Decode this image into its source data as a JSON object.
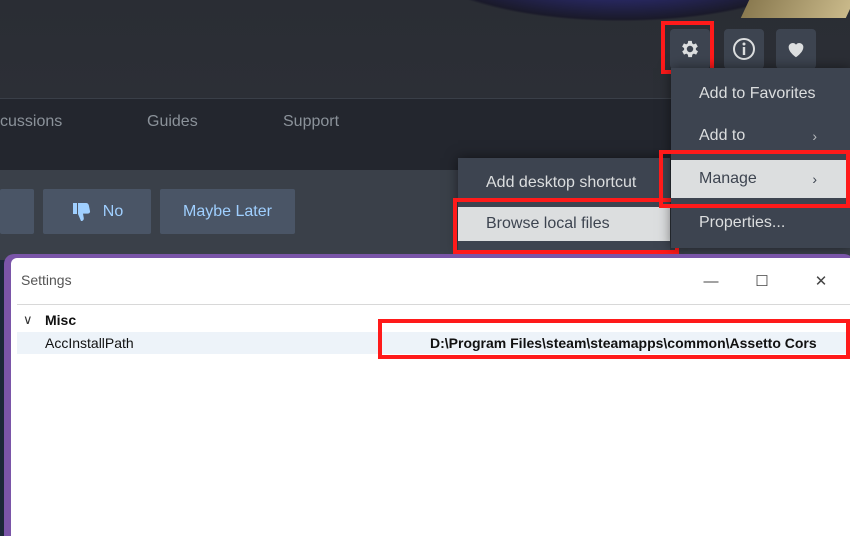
{
  "tabs": [
    "cussions",
    "Guides",
    "Support"
  ],
  "review_buttons": {
    "no": "No",
    "later": "Maybe Later"
  },
  "icons": {
    "settings": "gear-icon",
    "info": "info-icon",
    "favorite": "heart-icon",
    "thumb": "thumbs-down-icon"
  },
  "main_menu": {
    "items": [
      {
        "label": "Add to Favorites",
        "chevron": ""
      },
      {
        "label": "Add to",
        "chevron": "›"
      },
      {
        "label": "Manage",
        "chevron": "›"
      },
      {
        "label": "Properties..."
      }
    ]
  },
  "manage_submenu": {
    "items": [
      {
        "label": "Add desktop shortcut"
      },
      {
        "label": "Browse local files"
      }
    ]
  },
  "settings_window": {
    "title": "Settings",
    "controls": {
      "minimize": "—",
      "maximize": "☐",
      "close": "✕"
    },
    "category": {
      "arrow": "∨",
      "name": "Misc"
    },
    "property": {
      "key": "AccInstallPath",
      "value": "D:\\Program Files\\steam\\steamapps\\common\\Assetto Cors"
    }
  },
  "colors": {
    "highlight": "#ff1a1a",
    "menu_bg": "#3d4450",
    "window_border": "#7a55a8"
  }
}
